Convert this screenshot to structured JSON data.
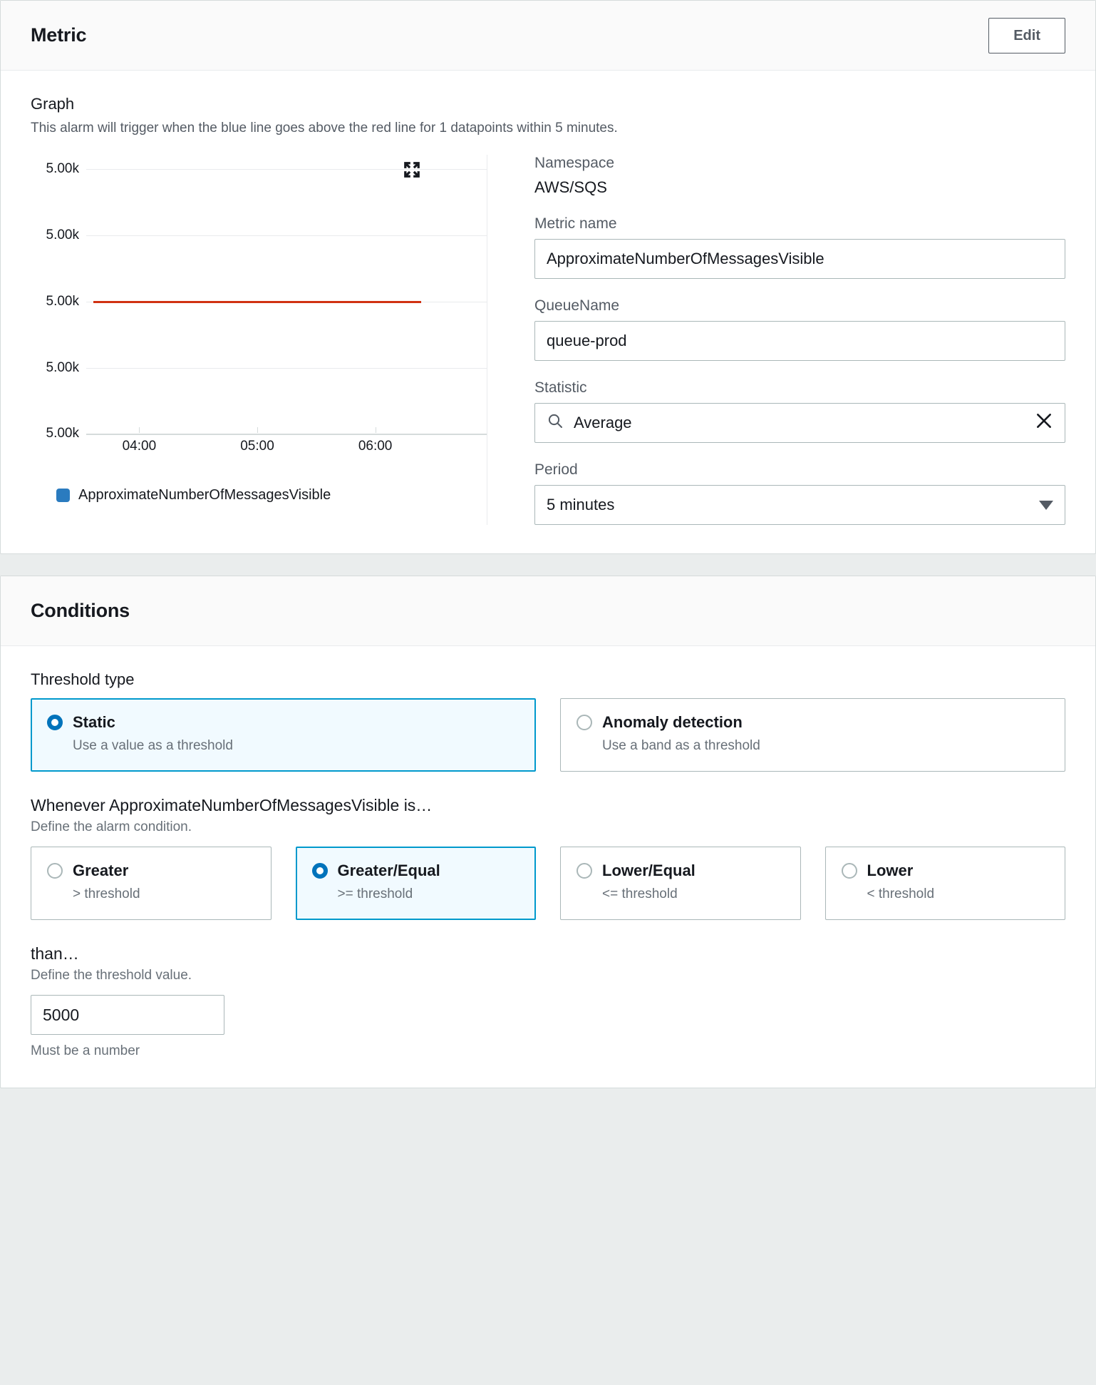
{
  "metric_panel": {
    "title": "Metric",
    "edit_label": "Edit",
    "graph_label": "Graph",
    "graph_description": "This alarm will trigger when the blue line goes above the red line for 1 datapoints within 5 minutes.",
    "expand_icon": "expand-icon",
    "fields": {
      "namespace_label": "Namespace",
      "namespace_value": "AWS/SQS",
      "metric_name_label": "Metric name",
      "metric_name_value": "ApproximateNumberOfMessagesVisible",
      "queue_name_label": "QueueName",
      "queue_name_value": "queue-prod",
      "statistic_label": "Statistic",
      "statistic_value": "Average",
      "statistic_search_icon": "search-icon",
      "statistic_clear_icon": "close-icon",
      "period_label": "Period",
      "period_value": "5 minutes",
      "period_caret_icon": "chevron-down-icon"
    }
  },
  "chart_data": {
    "type": "line",
    "title": "",
    "xlabel": "",
    "ylabel": "",
    "x_tick_labels": [
      "04:00",
      "05:00",
      "06:00"
    ],
    "x_tick_positions_pct": [
      14,
      50,
      86
    ],
    "y_tick_labels": [
      "5.00k",
      "5.00k",
      "5.00k",
      "5.00k",
      "5.00k"
    ],
    "y_tick_values": [
      5000,
      5000,
      5000,
      5000,
      5000
    ],
    "ylim": [
      5000,
      5000
    ],
    "grid": true,
    "legend_position": "bottom-left",
    "series": [
      {
        "name": "ApproximateNumberOfMessagesVisible",
        "color": "#2a7bbf",
        "values": []
      }
    ],
    "annotations": [
      {
        "name": "threshold",
        "type": "hline",
        "value": 5000,
        "color": "#d13212",
        "gridline_index": 2
      }
    ]
  },
  "conditions_panel": {
    "title": "Conditions",
    "threshold_type": {
      "label": "Threshold type",
      "options": [
        {
          "title": "Static",
          "description": "Use a value as a threshold",
          "selected": true
        },
        {
          "title": "Anomaly detection",
          "description": "Use a band as a threshold",
          "selected": false
        }
      ]
    },
    "comparison": {
      "heading": "Whenever ApproximateNumberOfMessagesVisible is…",
      "sub": "Define the alarm condition.",
      "options": [
        {
          "title": "Greater",
          "description": "> threshold",
          "selected": false
        },
        {
          "title": "Greater/Equal",
          "description": ">= threshold",
          "selected": true
        },
        {
          "title": "Lower/Equal",
          "description": "<= threshold",
          "selected": false
        },
        {
          "title": "Lower",
          "description": "< threshold",
          "selected": false
        }
      ]
    },
    "threshold_value": {
      "heading": "than…",
      "sub": "Define the threshold value.",
      "value": "5000",
      "hint": "Must be a number"
    }
  },
  "colors": {
    "accent_selected": "#0099cc",
    "accent_selected_bg": "#f1faff",
    "radio_on": "#0073bb",
    "threshold_line": "#d13212",
    "series_blue": "#2a7bbf"
  }
}
